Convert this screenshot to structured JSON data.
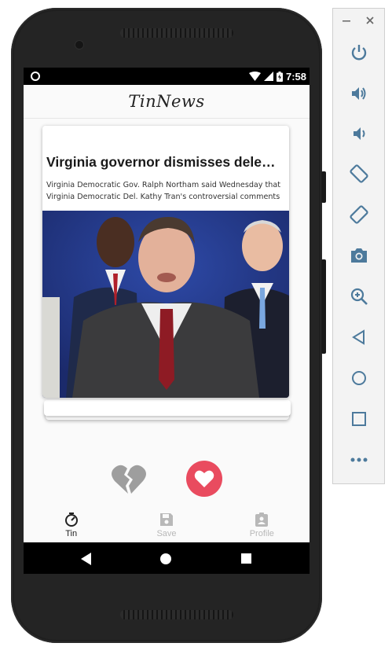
{
  "status_bar": {
    "time": "7:58"
  },
  "app": {
    "title": "TinNews"
  },
  "card": {
    "title": "Virginia governor dismisses delegat…",
    "description": "Virginia Democratic Gov. Ralph Northam said Wednesday that Virginia Democratic Del. Kathy Tran's controversial comments"
  },
  "bottom_nav": {
    "items": [
      {
        "label": "Tin",
        "active": true
      },
      {
        "label": "Save",
        "active": false
      },
      {
        "label": "Profile",
        "active": false
      }
    ]
  },
  "colors": {
    "like": "#e94b5f",
    "dislike": "#9e9e9e",
    "nav_active": "#222222",
    "nav_inactive": "#b8b8b8"
  },
  "emulator_toolbar": {
    "items": [
      "power-icon",
      "volume-up-icon",
      "volume-down-icon",
      "rotate-left-icon",
      "rotate-right-icon",
      "camera-icon",
      "zoom-icon",
      "back-icon",
      "home-icon",
      "overview-icon",
      "more-icon"
    ]
  }
}
